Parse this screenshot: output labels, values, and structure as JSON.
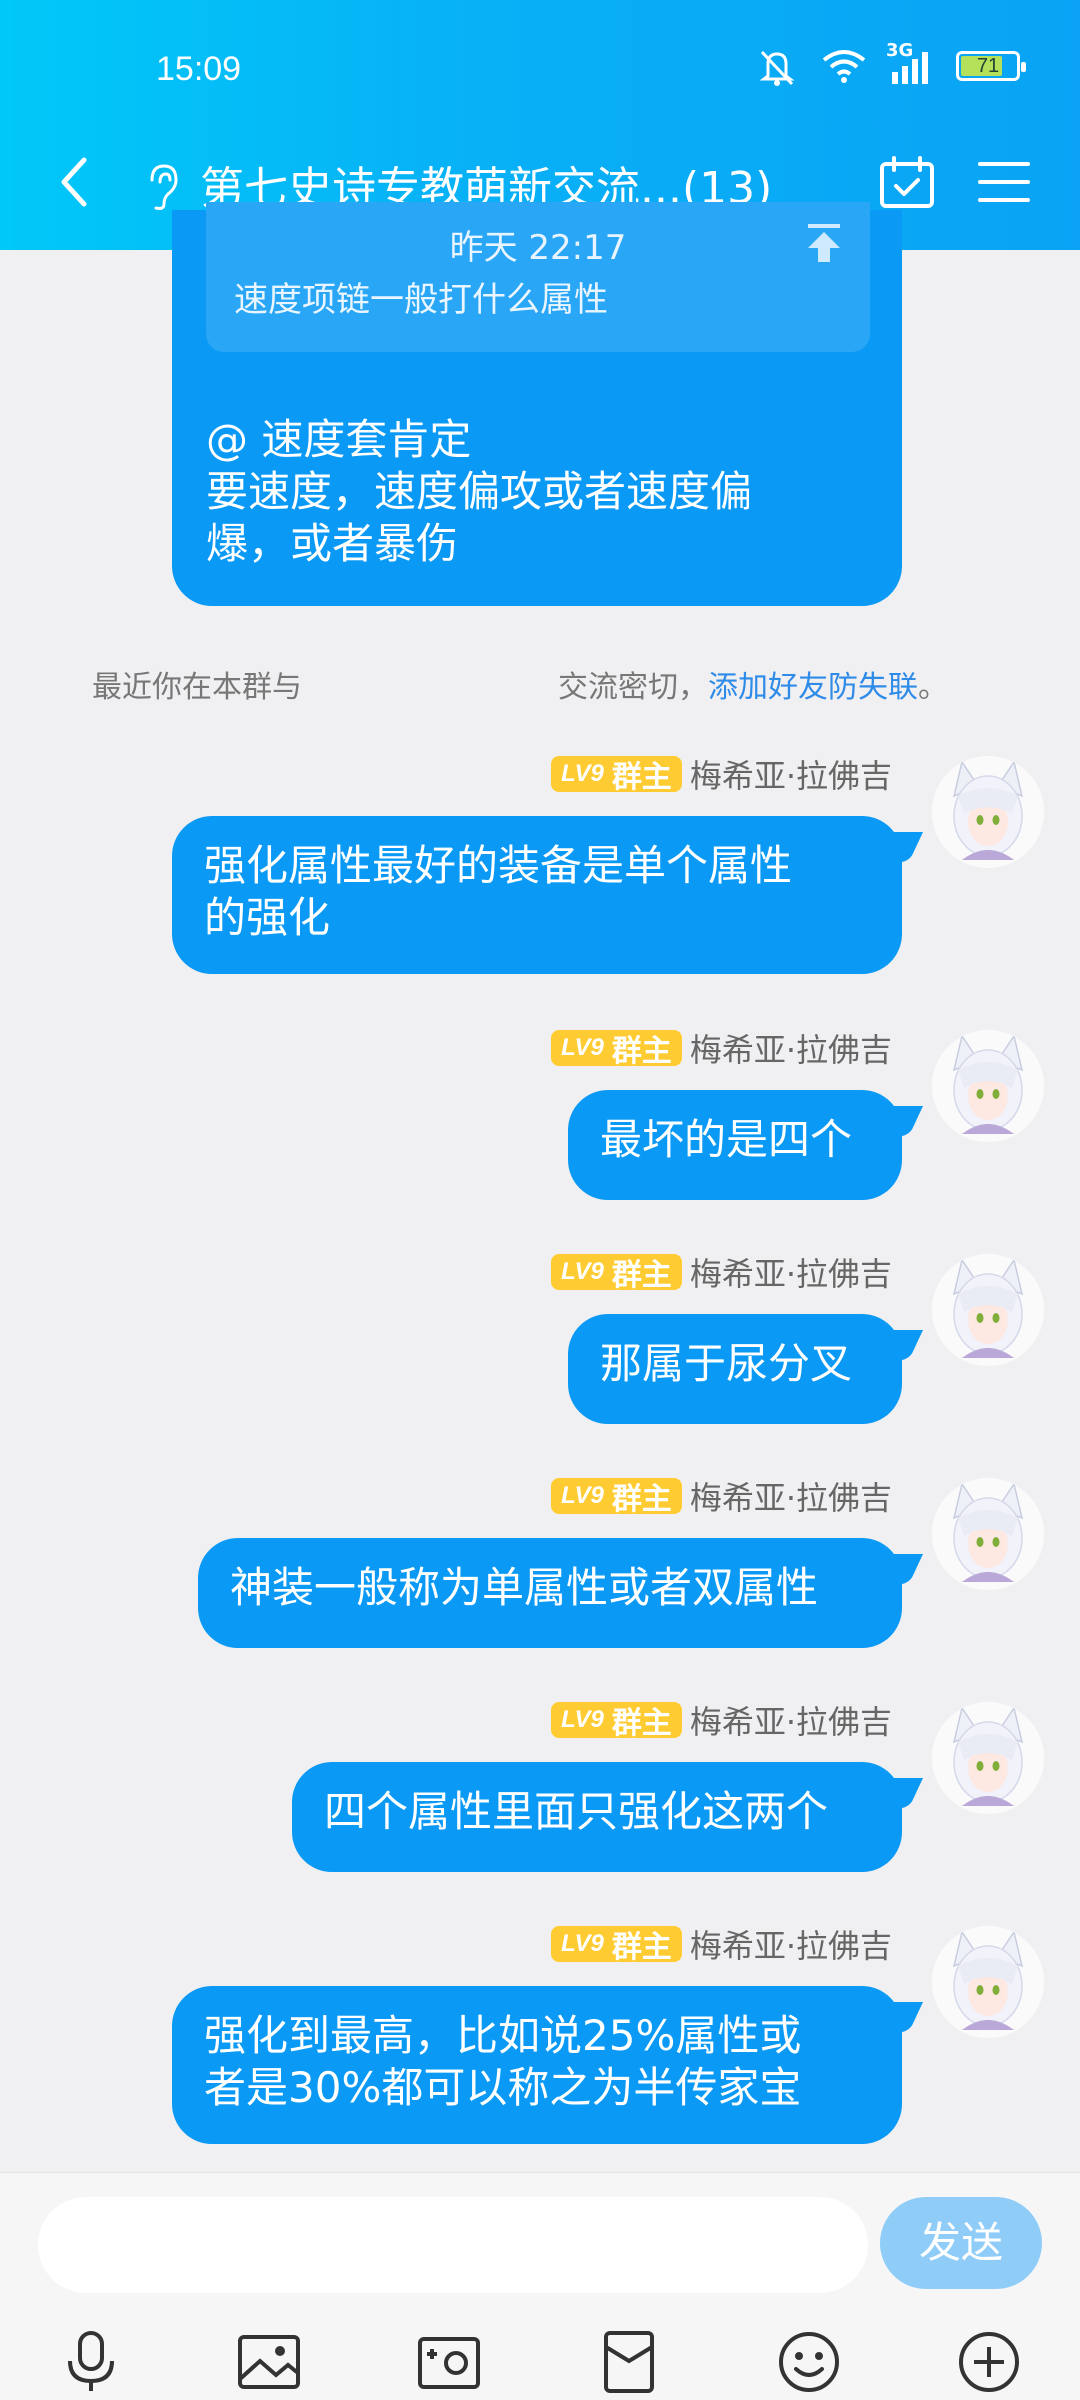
{
  "status_bar": {
    "time": "15:09",
    "network": "3G",
    "battery": "71"
  },
  "header": {
    "title": "第七史诗专教萌新交流...(13)"
  },
  "quoted_message": {
    "quote": {
      "time": "昨天 22:17",
      "text": "速度项链一般打什么属性"
    },
    "reply_text": "@                             速度套肯定\n要速度，速度偏攻或者速度偏\n爆，或者暴伤"
  },
  "notice": {
    "prefix": "最近你在本群与",
    "suffix": "交流密切，",
    "link": "添加好友防失联",
    "end": "。"
  },
  "messages": [
    {
      "level": "LV9",
      "role": "群主",
      "sender": "梅希亚·拉佛吉",
      "text": "强化属性最好的装备是单个属性\n的强化"
    },
    {
      "level": "LV9",
      "role": "群主",
      "sender": "梅希亚·拉佛吉",
      "text": "最坏的是四个"
    },
    {
      "level": "LV9",
      "role": "群主",
      "sender": "梅希亚·拉佛吉",
      "text": "那属于尿分叉"
    },
    {
      "level": "LV9",
      "role": "群主",
      "sender": "梅希亚·拉佛吉",
      "text": "神装一般称为单属性或者双属性"
    },
    {
      "level": "LV9",
      "role": "群主",
      "sender": "梅希亚·拉佛吉",
      "text": "四个属性里面只强化这两个"
    },
    {
      "level": "LV9",
      "role": "群主",
      "sender": "梅希亚·拉佛吉",
      "text": "强化到最高，比如说25%属性或\n者是30%都可以称之为半传家宝"
    }
  ],
  "input": {
    "placeholder": "",
    "send_label": "发送"
  },
  "toolbar": [
    "microphone-icon",
    "image-icon",
    "camera-icon",
    "red-packet-icon",
    "emoji-icon",
    "plus-icon"
  ],
  "colors": {
    "header_start": "#00c8f8",
    "header_end": "#0aa3f5",
    "bubble": "#0a99f5",
    "badge": "#ffcb33",
    "link": "#2f8be8"
  }
}
